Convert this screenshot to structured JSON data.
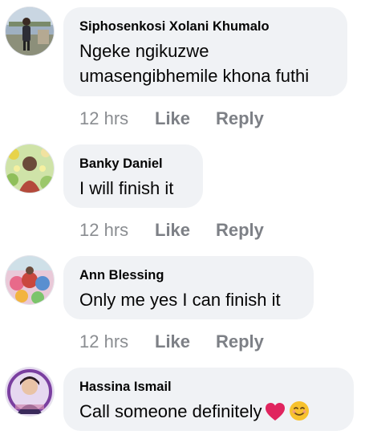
{
  "comments": [
    {
      "author": "Siphosenkosi Xolani Khumalo",
      "lines": [
        "Ngeke ngikuzwe",
        "umasengibhemile khona futhi"
      ],
      "time": "12 hrs",
      "like": "Like",
      "reply": "Reply",
      "avatar_icon": "profile-photo-person-outdoors"
    },
    {
      "author": "Banky Daniel",
      "lines": [
        "I will finish it"
      ],
      "time": "12 hrs",
      "like": "Like",
      "reply": "Reply",
      "avatar_icon": "profile-photo-person-flowers"
    },
    {
      "author": "Ann Blessing",
      "lines": [
        "Only me yes I can finish it"
      ],
      "time": "12 hrs",
      "like": "Like",
      "reply": "Reply",
      "avatar_icon": "profile-photo-colorful-group"
    },
    {
      "author": "Hassina Ismail",
      "lines": [
        "Call someone definitely"
      ],
      "emojis": [
        "red-heart-emoji",
        "smiling-face-emoji"
      ]
    }
  ],
  "colors": {
    "bubble": "#f0f2f5",
    "meta": "#8a8d91",
    "text": "#050505",
    "heart": "#e0245e",
    "smile": "#f7c22e"
  }
}
